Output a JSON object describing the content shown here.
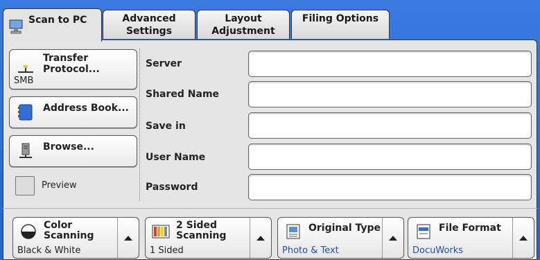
{
  "tabs": {
    "scan_to_pc": "Scan to PC",
    "advanced_1": "Advanced",
    "advanced_2": "Settings",
    "layout_1": "Layout",
    "layout_2": "Adjustment",
    "filing": "Filing Options"
  },
  "left": {
    "transfer_1": "Transfer",
    "transfer_2": "Protocol...",
    "transfer_value": "SMB",
    "address_book": "Address Book...",
    "browse": "Browse...",
    "preview": "Preview"
  },
  "fields": {
    "server": "Server",
    "shared_name": "Shared Name",
    "save_in": "Save in",
    "user_name": "User Name",
    "password": "Password"
  },
  "features": {
    "color_1": "Color",
    "color_2": "Scanning",
    "color_value": "Black & White",
    "sided_1": "2 Sided",
    "sided_2": "Scanning",
    "sided_value": "1 Sided",
    "original_type": "Original Type",
    "original_value": "Photo & Text",
    "file_format": "File Format",
    "file_value": "DocuWorks"
  },
  "icons": [
    "computer-icon",
    "network-icon",
    "address-book-icon",
    "server-icon",
    "color-icon",
    "sided-icon",
    "original-type-icon",
    "file-format-icon",
    "up-arrow-icon"
  ]
}
